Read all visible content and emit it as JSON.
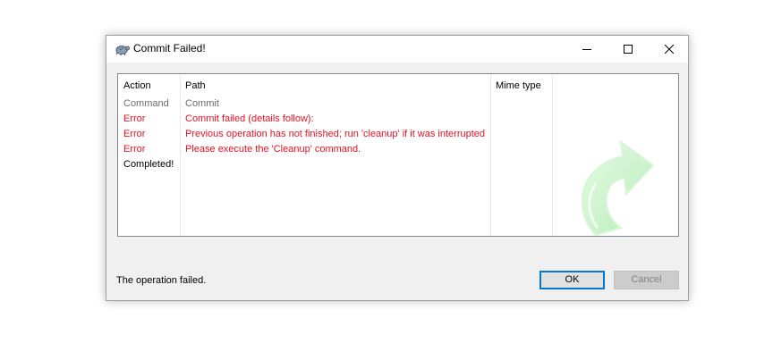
{
  "window": {
    "title": "Commit Failed!",
    "controls": {
      "minimize_icon": "minimize-icon",
      "maximize_icon": "maximize-icon",
      "close_icon": "close-icon"
    }
  },
  "list": {
    "columns": {
      "action": "Action",
      "path": "Path",
      "mime": "Mime type"
    },
    "rows": [
      {
        "action": "Command",
        "path": "Commit",
        "kind": "command"
      },
      {
        "action": "Error",
        "path": "Commit failed (details follow):",
        "kind": "error"
      },
      {
        "action": "Error",
        "path": "Previous operation has not finished; run 'cleanup' if it was interrupted",
        "kind": "error"
      },
      {
        "action": "Error",
        "path": "Please execute the 'Cleanup' command.",
        "kind": "error"
      },
      {
        "action": "Completed!",
        "path": "",
        "kind": "completed"
      }
    ]
  },
  "status": {
    "text": "The operation failed."
  },
  "buttons": {
    "ok": "OK",
    "cancel": "Cancel"
  },
  "colors": {
    "error": "#e81123",
    "command": "#6d6d6d",
    "accent": "#0078d7",
    "arrow": "#c8f5c8"
  }
}
